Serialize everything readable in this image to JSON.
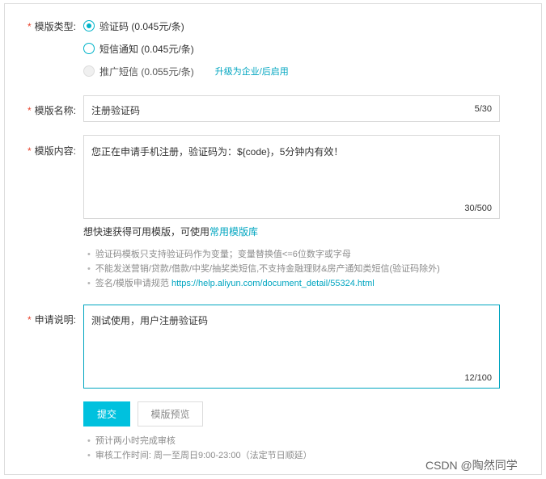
{
  "form": {
    "template_type": {
      "label": "模版类型:",
      "options": [
        {
          "text": "验证码 (0.045元/条)",
          "checked": true,
          "disabled": false
        },
        {
          "text": "短信通知 (0.045元/条)",
          "checked": false,
          "disabled": false
        },
        {
          "text": "推广短信 (0.055元/条)",
          "checked": false,
          "disabled": true
        }
      ],
      "upgrade_link": "升级为企业/后启用"
    },
    "template_name": {
      "label": "模版名称:",
      "value": "注册验证码",
      "counter": "5/30"
    },
    "template_content": {
      "label": "模版内容:",
      "value": "您正在申请手机注册，验证码为：${code}，5分钟内有效！",
      "counter": "30/500"
    },
    "library_hint": {
      "prefix": "想快速获得可用模版，可使用",
      "link": "常用模版库"
    },
    "tips": [
      "验证码模板只支持验证码作为变量；变量替换值<=6位数字或字母",
      "不能发送营销/贷款/借款/中奖/抽奖类短信,不支持金融理财&房产通知类短信(验证码除外)"
    ],
    "spec_tip": {
      "prefix": "签名/模版申请规范 ",
      "link": "https://help.aliyun.com/document_detail/55324.html"
    },
    "description": {
      "label": "申请说明:",
      "value": "测试使用，用户注册验证码",
      "counter": "12/100"
    },
    "submit_label": "提交",
    "preview_label": "模版预览",
    "review_tips": [
      "预计两小时完成审核",
      "审核工作时间: 周一至周日9:00-23:00（法定节日顺延）"
    ]
  },
  "watermark": "CSDN @陶然同学",
  "colors": {
    "accent": "#00c1de",
    "link": "#00a5c0",
    "required": "#e8452f"
  }
}
